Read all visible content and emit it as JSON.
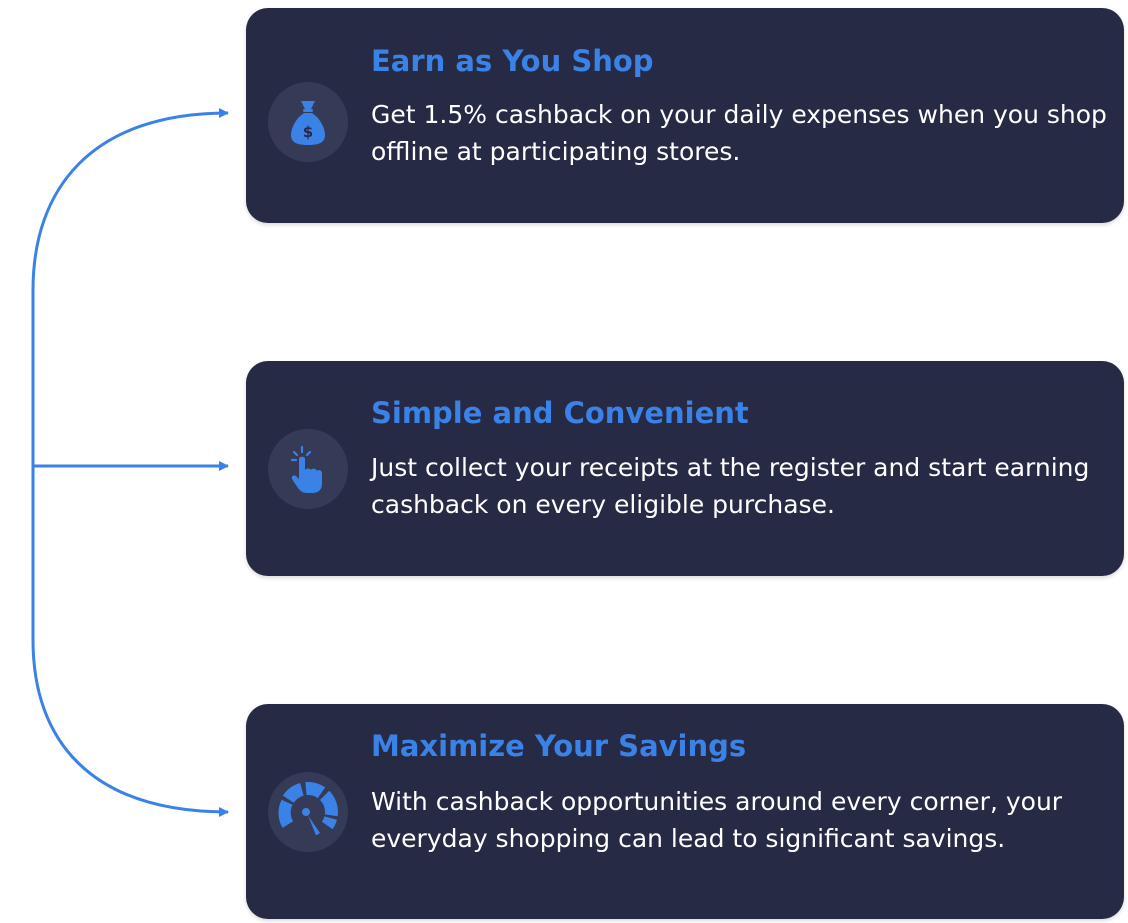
{
  "colors": {
    "card_background": "#272a45",
    "icon_circle": "#353a56",
    "accent": "#3b82e6",
    "text": "#ffffff",
    "connector": "#3b82e6"
  },
  "cards": [
    {
      "title": "Earn as You Shop",
      "description": "Get 1.5% cashback on your daily expenses when you shop offline at participating stores.",
      "icon": "money-bag-icon"
    },
    {
      "title": "Simple and Convenient",
      "description": "Just collect your receipts at the register and start earning cashback on every eligible purchase.",
      "icon": "tap-hand-icon"
    },
    {
      "title": "Maximize Your Savings",
      "description": "With cashback opportunities around every corner, your everyday shopping can lead to significant savings.",
      "icon": "speedometer-icon"
    }
  ]
}
